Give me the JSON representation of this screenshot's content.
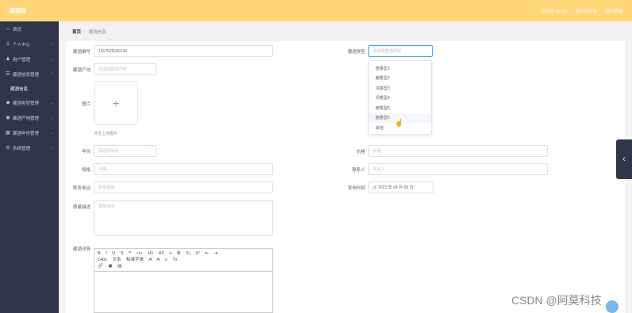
{
  "header": {
    "brand": "藏酒网",
    "links": [
      "欢迎您 admin",
      "退出到前台",
      "退出登录"
    ]
  },
  "sidebar": {
    "items": [
      {
        "label": "首页",
        "icon": "home-icon",
        "chevron": false
      },
      {
        "label": "个人中心",
        "icon": "user-icon",
        "chevron": true
      },
      {
        "label": "用户管理",
        "icon": "users-icon",
        "chevron": true
      },
      {
        "label": "藏酒信息管理",
        "icon": "list-icon",
        "chevron": true
      },
      {
        "label": "藏酒信息",
        "icon": "",
        "chevron": false,
        "sub": true
      },
      {
        "label": "藏酒类型管理",
        "icon": "tag-icon",
        "chevron": true
      },
      {
        "label": "藏酒产地管理",
        "icon": "pin-icon",
        "chevron": true
      },
      {
        "label": "藏酒年份管理",
        "icon": "calendar-icon",
        "chevron": true
      },
      {
        "label": "系统管理",
        "icon": "gear-icon",
        "chevron": true
      }
    ]
  },
  "breadcrumb": {
    "home": "首页",
    "current": "藏酒信息"
  },
  "form": {
    "code_label": "藏酒编号",
    "code_value": "1617529100136",
    "type_label": "藏酒类型",
    "type_placeholder": "请选择藏酒类型",
    "origin_label": "藏酒产地",
    "origin_placeholder": "请选择藏酒产地",
    "image_label": "图片",
    "upload_tip": "点击上传图片",
    "year_label": "年份",
    "year_placeholder": "请选择年份",
    "price_label": "价格",
    "price_placeholder": "价格",
    "spec_label": "规格",
    "spec_placeholder": "规格",
    "contact_label": "联系人",
    "contact_placeholder": "联系人",
    "phone_label": "联系电话",
    "phone_placeholder": "联系电话",
    "date_label": "发布时间",
    "date_value": "2021 年 04 月 05 日",
    "remark_label": "质量描述",
    "remark_placeholder": "质量描述",
    "detail_label": "藏酒详情"
  },
  "type_dropdown": {
    "options": [
      "酱香型1",
      "酱香型2",
      "浓香型3",
      "清香型4",
      "酱香型5",
      "酱香型6",
      "其他"
    ],
    "hovered_index": 5
  },
  "editor": {
    "row1": [
      "B",
      "I",
      "U",
      "S",
      "❝",
      "</>",
      "H1",
      "H2",
      "≡",
      "≣",
      "X₂",
      "X²",
      "⇤",
      "⇥"
    ],
    "row2": [
      "14px",
      "文本",
      "标准字体",
      "A",
      "A",
      "≡",
      "Tx"
    ],
    "row3": [
      "🔗",
      "▣",
      "▤"
    ]
  },
  "watermark": "CSDN @阿莫科技"
}
